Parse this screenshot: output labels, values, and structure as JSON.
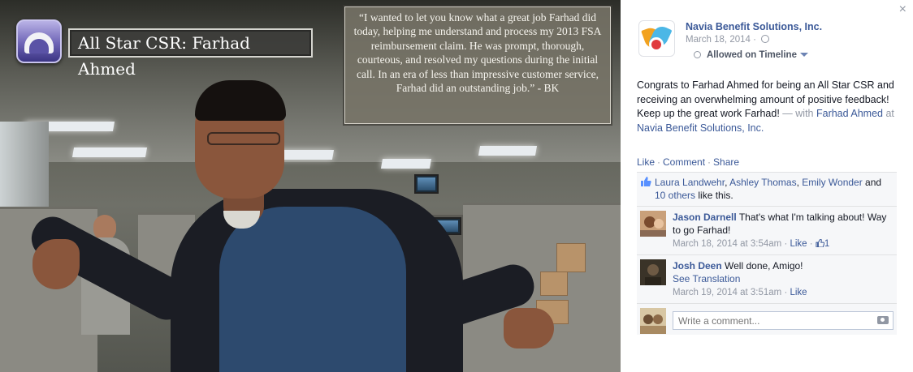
{
  "photo": {
    "title": "All Star CSR: Farhad Ahmed",
    "quote": "“I wanted  to let you know  what  a great job Farhad did today, helping me understand  and process  my 2013 FSA reimbursement  claim. He was prompt, thorough, courteous, and resolved my questions  during  the initial call. In an era of less than impressive  customer service, Farhad did an outstanding  job.” - BK"
  },
  "post": {
    "page_name": "Navia Benefit Solutions, Inc.",
    "date": "March 18, 2014 · ",
    "timeline_label": "Allowed on Timeline",
    "body_text": "Congrats to Farhad Ahmed for being an All Star CSR and receiving an overwhelming amount of positive feedback! Keep up the great work Farhad!",
    "with_text": " — with",
    "tagged_person": "Farhad Ahmed",
    "at_text": " at ",
    "tagged_place": "Navia Benefit Solutions, Inc."
  },
  "actions": {
    "like": "Like",
    "comment": "Comment",
    "share": "Share",
    "sep": "·"
  },
  "likes": {
    "person1": "Laura Landwehr",
    "person2": "Ashley Thomas",
    "person3": "Emily Wonder",
    "and_text": " and",
    "others": "10 others",
    "tail": " like this."
  },
  "comments": [
    {
      "author": "Jason Darnell",
      "text": " That's what I'm talking about! Way to go Farhad!",
      "date": "March 18, 2014 at 3:54am",
      "like_label": "Like",
      "like_count": "1"
    },
    {
      "author": "Josh Deen",
      "text": " Well done, Amigo!",
      "translation": "See Translation",
      "date": "March 19, 2014 at 3:51am",
      "like_label": "Like"
    }
  ],
  "composer": {
    "placeholder": "Write a comment..."
  },
  "close_glyph": "×",
  "colors": {
    "link": "#3b5998",
    "muted": "#9197a3",
    "ufi_bg": "#f6f7f9"
  }
}
